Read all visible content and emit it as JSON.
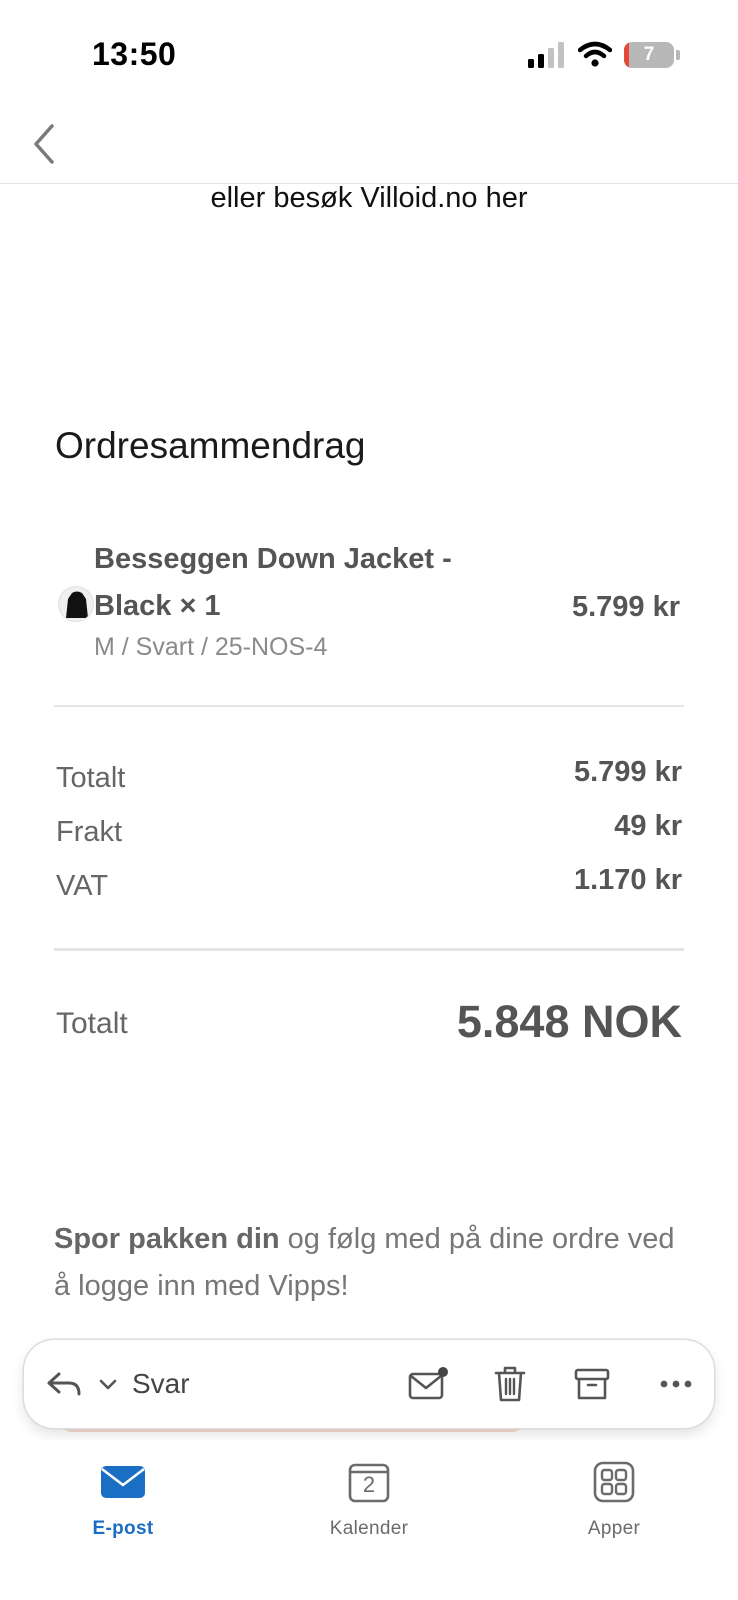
{
  "status_bar": {
    "time": "13:50",
    "battery_level": "7",
    "icons": [
      "cellular-signal-icon",
      "wifi-icon",
      "battery-icon"
    ]
  },
  "nav": {
    "back_icon": "chevron-left-icon"
  },
  "email": {
    "visit_prefix": "eller besøk ",
    "visit_link": "Villoid.no her",
    "summary_title": "Ordresammendrag",
    "item": {
      "name": "Besseggen Down Jacket - Black × 1",
      "variant": "M / Svart / 25-NOS-4",
      "price": "5.799 kr",
      "thumbnail_icon": "jacket-thumbnail"
    },
    "summary": {
      "totalt_label": "Totalt",
      "totalt_value": "5.799 kr",
      "frakt_label": "Frakt",
      "frakt_value": "49 kr",
      "vat_label": "VAT",
      "vat_value": "1.170 kr"
    },
    "grand_total": {
      "label": "Totalt",
      "value": "5.848 NOK"
    },
    "tracking": {
      "bold": "Spor pakken din",
      "rest": " og følg med på dine ordre ved å logge inn med Vipps!"
    }
  },
  "reply_bar": {
    "reply_label": "Svar",
    "icons": [
      "reply-icon",
      "chevron-down-icon",
      "mark-unread-icon",
      "trash-icon",
      "archive-icon",
      "more-icon"
    ]
  },
  "tab_bar": {
    "tabs": [
      {
        "label": "E-post",
        "icon": "mail-icon",
        "active": true
      },
      {
        "label": "Kalender",
        "icon": "calendar-icon",
        "day": "2",
        "active": false
      },
      {
        "label": "Apper",
        "icon": "apps-grid-icon",
        "active": false
      }
    ]
  },
  "colors": {
    "accent_blue": "#1a6fc4",
    "battery_red": "#e5483b",
    "text_gray": "#555555"
  }
}
